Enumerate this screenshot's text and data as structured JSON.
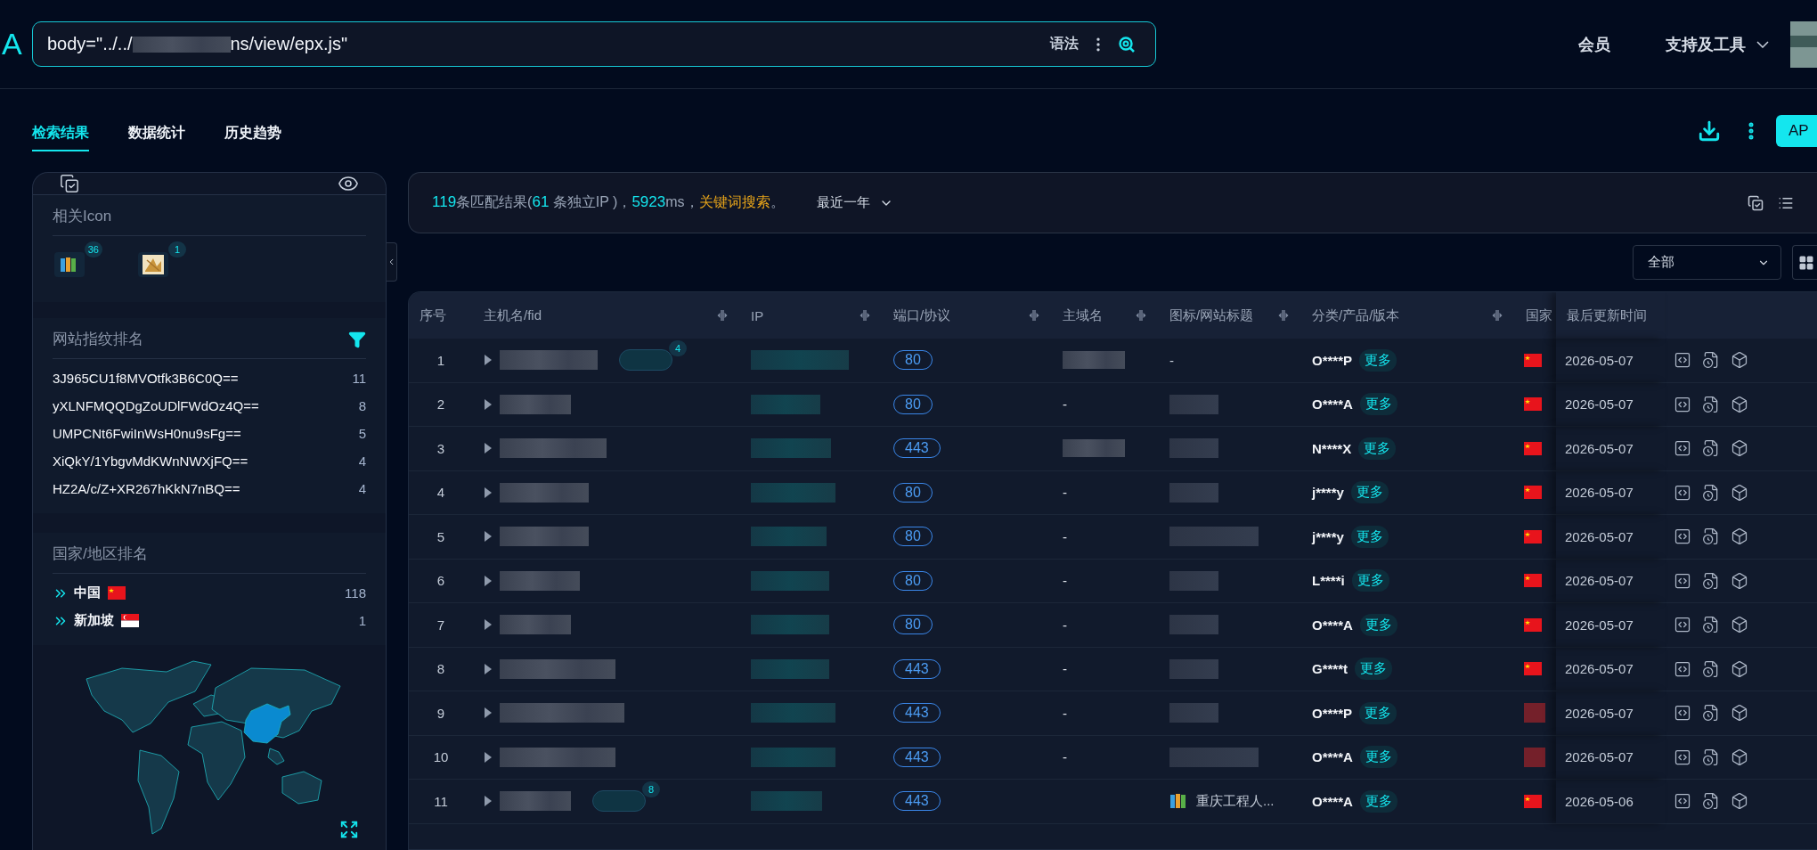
{
  "logo": "A",
  "search": {
    "query_start": "body=\"../../",
    "query_end": "ns/view/epx.js\"",
    "syntax": "语法"
  },
  "nav": [
    {
      "label": "会员",
      "dropdown": false
    },
    {
      "label": "支持及工具",
      "dropdown": true
    }
  ],
  "tabs": [
    {
      "label": "检索结果",
      "selected": true
    },
    {
      "label": "数据统计",
      "selected": false
    },
    {
      "label": "历史趋势",
      "selected": false
    }
  ],
  "api_button": "AP",
  "sidebar": {
    "icons_title": "相关Icon",
    "icons": [
      {
        "kind": "books",
        "count": "36"
      },
      {
        "kind": "sketch",
        "count": "1"
      }
    ],
    "fingerprint_title": "网站指纹排名",
    "fingerprints": [
      {
        "text": "3J965CU1f8MVOtfk3B6C0Q==",
        "count": "11"
      },
      {
        "text": "yXLNFMQQDgZoUDlFWdOz4Q==",
        "count": "8"
      },
      {
        "text": "UMPCNt6FwiInWsH0nu9sFg==",
        "count": "5"
      },
      {
        "text": "XiQkY/1YbgvMdKWnNWXjFQ==",
        "count": "4"
      },
      {
        "text": "HZ2A/c/Z+XR267hKkN7nBQ==",
        "count": "4"
      }
    ],
    "country_title": "国家/地区排名",
    "countries": [
      {
        "name": "中国",
        "kind": "cn",
        "count": "118"
      },
      {
        "name": "新加坡",
        "kind": "sg",
        "count": "1"
      }
    ]
  },
  "summary": {
    "segments": [
      {
        "kind": "number",
        "text": "119"
      },
      {
        "kind": "plain",
        "text": "条匹配结果("
      },
      {
        "kind": "number",
        "text": "61"
      },
      {
        "kind": "plain",
        "text": " 条独立IP )，"
      },
      {
        "kind": "number",
        "text": "5923"
      },
      {
        "kind": "plain",
        "text": "ms，"
      },
      {
        "kind": "keyword",
        "text": "关键词搜索"
      },
      {
        "kind": "plain",
        "text": "。"
      }
    ],
    "range": "最近一年"
  },
  "filter": "全部",
  "table": {
    "columns": [
      "序号",
      "主机名/fid",
      "IP",
      "端口/协议",
      "主域名",
      "图标/网站标题",
      "分类/产品/版本",
      "国家",
      "最后更新时间"
    ],
    "rows": [
      {
        "num": "1",
        "fid_count": "4",
        "port": "80",
        "domain_blurred": true,
        "title_blurred": false,
        "title": "-",
        "product": "O****P",
        "more": "更多",
        "flag_blurred": false,
        "date": "2026-05-07"
      },
      {
        "num": "2",
        "port": "80",
        "domain_blurred": false,
        "domain": "-",
        "title_blurred": true,
        "product": "O****A",
        "more": "更多",
        "flag_blurred": false,
        "date": "2026-05-07"
      },
      {
        "num": "3",
        "port": "443",
        "domain_blurred": true,
        "title_blurred": true,
        "product": "N****X",
        "more": "更多",
        "flag_blurred": false,
        "date": "2026-05-07"
      },
      {
        "num": "4",
        "port": "80",
        "domain_blurred": false,
        "domain": "-",
        "title_blurred": true,
        "product": "j****y",
        "more": "更多",
        "flag_blurred": false,
        "date": "2026-05-07"
      },
      {
        "num": "5",
        "port": "80",
        "domain_blurred": false,
        "domain": "-",
        "title_blurred": true,
        "product": "j****y",
        "more": "更多",
        "flag_blurred": false,
        "date": "2026-05-07"
      },
      {
        "num": "6",
        "port": "80",
        "domain_blurred": false,
        "domain": "-",
        "title_blurred": true,
        "product": "L****i",
        "more": "更多",
        "flag_blurred": false,
        "date": "2026-05-07"
      },
      {
        "num": "7",
        "port": "80",
        "domain_blurred": false,
        "domain": "-",
        "title_blurred": true,
        "product": "O****A",
        "more": "更多",
        "flag_blurred": false,
        "date": "2026-05-07"
      },
      {
        "num": "8",
        "port": "443",
        "domain_blurred": false,
        "domain": "-",
        "title_blurred": true,
        "product": "G****t",
        "more": "更多",
        "flag_blurred": false,
        "date": "2026-05-07"
      },
      {
        "num": "9",
        "port": "443",
        "domain_blurred": false,
        "domain": "-",
        "title_blurred": true,
        "product": "O****P",
        "more": "更多",
        "flag_blurred": true,
        "date": "2026-05-07"
      },
      {
        "num": "10",
        "port": "443",
        "domain_blurred": false,
        "domain": "-",
        "title_blurred": true,
        "product": "O****A",
        "more": "更多",
        "flag_blurred": true,
        "date": "2026-05-07"
      },
      {
        "num": "11",
        "fid_count": "8",
        "port": "443",
        "domain_blurred": false,
        "title_blurred": false,
        "title": "重庆工程人...",
        "title_icon": true,
        "product": "O****A",
        "more": "更多",
        "flag_blurred": false,
        "date": "2026-05-06"
      }
    ]
  }
}
